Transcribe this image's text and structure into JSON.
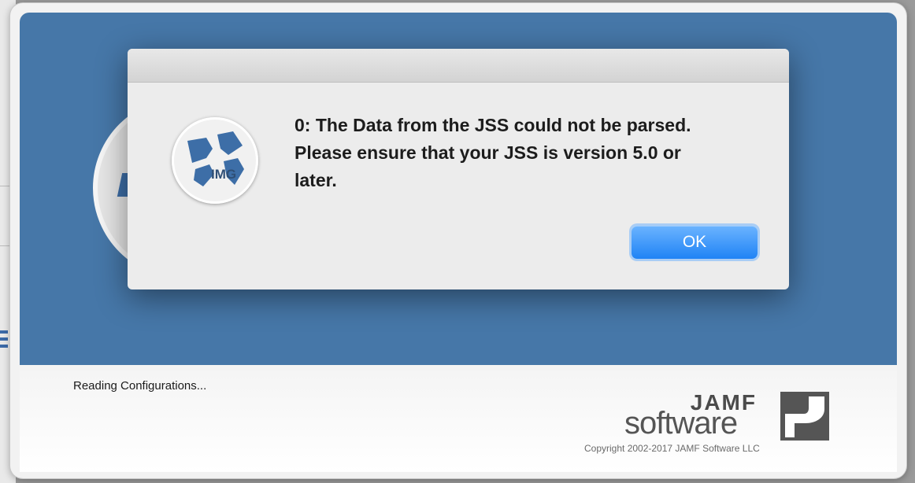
{
  "splash": {
    "status": "Reading Configurations...",
    "brand_jamf": "JAMF",
    "brand_software": "software",
    "copyright": "Copyright 2002-2017 JAMF Software LLC"
  },
  "dialog": {
    "icon_label": "IMG",
    "message": "0: The Data from the JSS could not be parsed. Please ensure that your JSS is version 5.0 or later.",
    "ok_label": "OK"
  },
  "colors": {
    "splash_blue": "#4677a8",
    "button_blue": "#1f83f5",
    "icon_blue": "#3d6ea7"
  }
}
